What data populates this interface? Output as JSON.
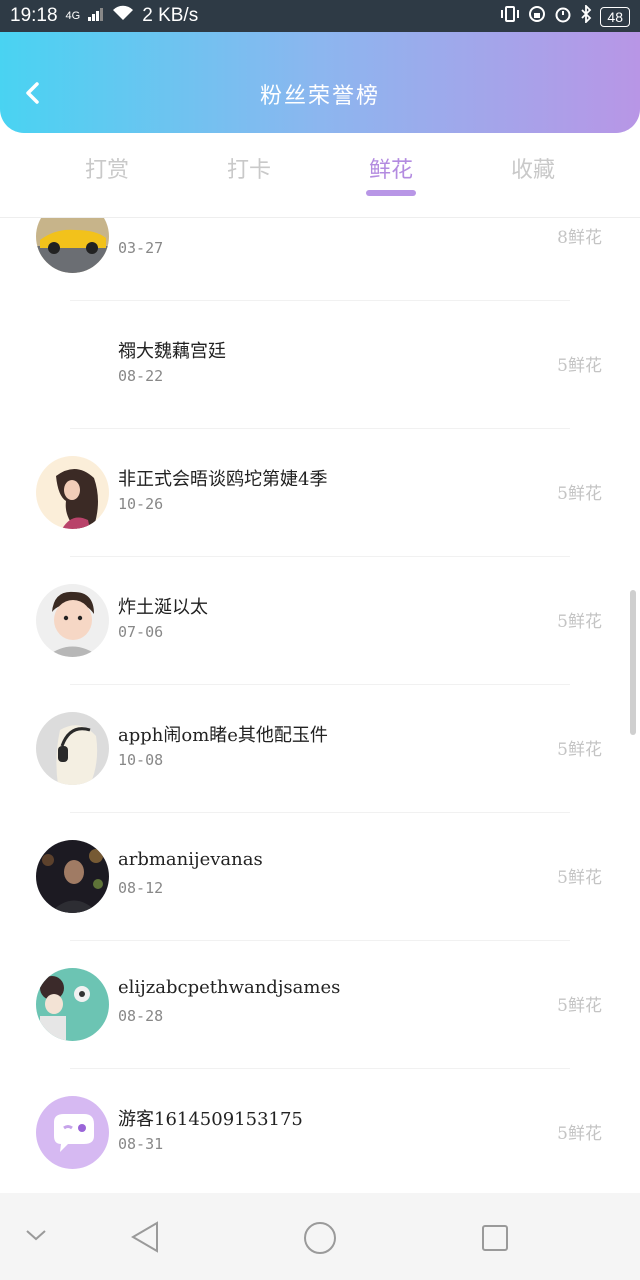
{
  "status_bar": {
    "time": "19:18",
    "network": "4G",
    "speed": "2 KB/s",
    "battery": "48"
  },
  "header": {
    "title": "粉丝荣誉榜",
    "back_icon": "chevron-left-icon"
  },
  "tabs": [
    {
      "label": "打赏",
      "active": false
    },
    {
      "label": "打卡",
      "active": false
    },
    {
      "label": "鲜花",
      "active": true
    },
    {
      "label": "收藏",
      "active": false
    }
  ],
  "rows": [
    {
      "name": "",
      "date": "03-27",
      "amount": "8鲜花",
      "avatar": "car-avatar"
    },
    {
      "name": "禤大魏藕宫廷",
      "date": "08-22",
      "amount": "5鲜花",
      "avatar": "none"
    },
    {
      "name": "非正式会晤谈鸥坨第婕4季",
      "date": "10-26",
      "amount": "5鲜花",
      "avatar": "girl-avatar"
    },
    {
      "name": "炸土涎以太",
      "date": "07-06",
      "amount": "5鲜花",
      "avatar": "boy-avatar"
    },
    {
      "name": "apph闹om睹e其他配玉件",
      "date": "10-08",
      "amount": "5鲜花",
      "avatar": "headphones-avatar"
    },
    {
      "name": "arbmanijevanas",
      "date": "08-12",
      "amount": "5鲜花",
      "avatar": "night-avatar"
    },
    {
      "name": "elijzabcpethwandjsames",
      "date": "08-28",
      "amount": "5鲜花",
      "avatar": "couple-avatar"
    },
    {
      "name": "游客1614509153175",
      "date": "08-31",
      "amount": "5鲜花",
      "avatar": "chat-bubble-avatar"
    }
  ],
  "nav": {
    "down_icon": "chevron-down-icon",
    "back_icon": "triangle-back-icon",
    "home_icon": "circle-home-icon",
    "recent_icon": "square-recent-icon"
  },
  "colors": {
    "header_gradient_start": "#49d3f2",
    "header_gradient_end": "#b896e6",
    "tab_active": "#b38be0",
    "tab_inactive": "#c9c9c9"
  }
}
